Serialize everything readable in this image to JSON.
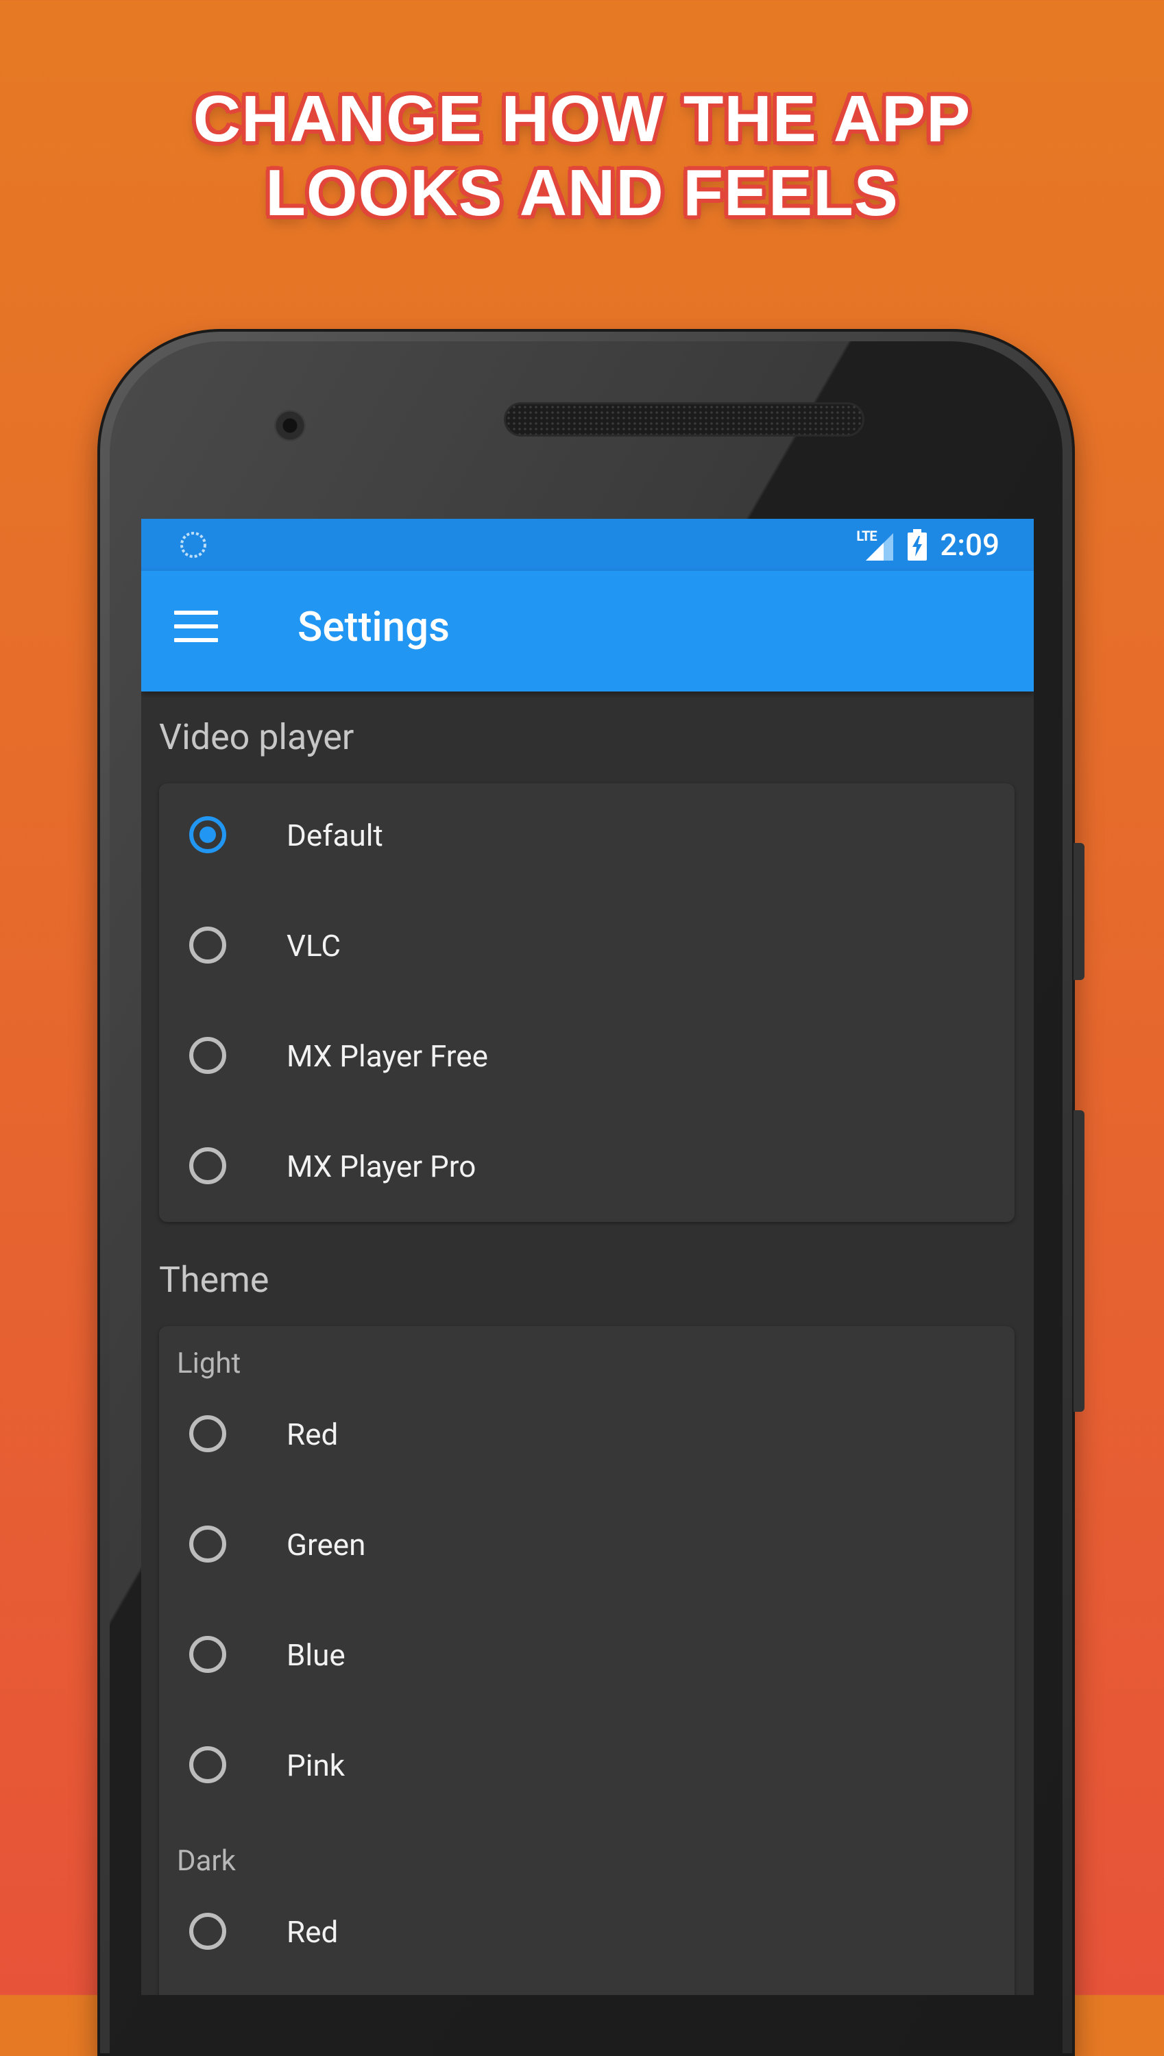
{
  "promo": {
    "headline_line1": "CHANGE HOW THE APP",
    "headline_line2": "LOOKS AND FEELS"
  },
  "statusbar": {
    "network": "LTE",
    "time": "2:09"
  },
  "appbar": {
    "title": "Settings",
    "menu_icon": "hamburger-menu-icon"
  },
  "video_player": {
    "section_title": "Video player",
    "selected": "Default",
    "options": [
      "Default",
      "VLC",
      "MX Player Free",
      "MX Player Pro"
    ]
  },
  "theme": {
    "section_title": "Theme",
    "light_label": "Light",
    "light_options": [
      "Red",
      "Green",
      "Blue",
      "Pink"
    ],
    "dark_label": "Dark",
    "dark_options": [
      "Red"
    ]
  },
  "colors": {
    "accent": "#2196F3",
    "statusbar": "#1E88E5",
    "background": "#303030",
    "card": "#373737"
  }
}
